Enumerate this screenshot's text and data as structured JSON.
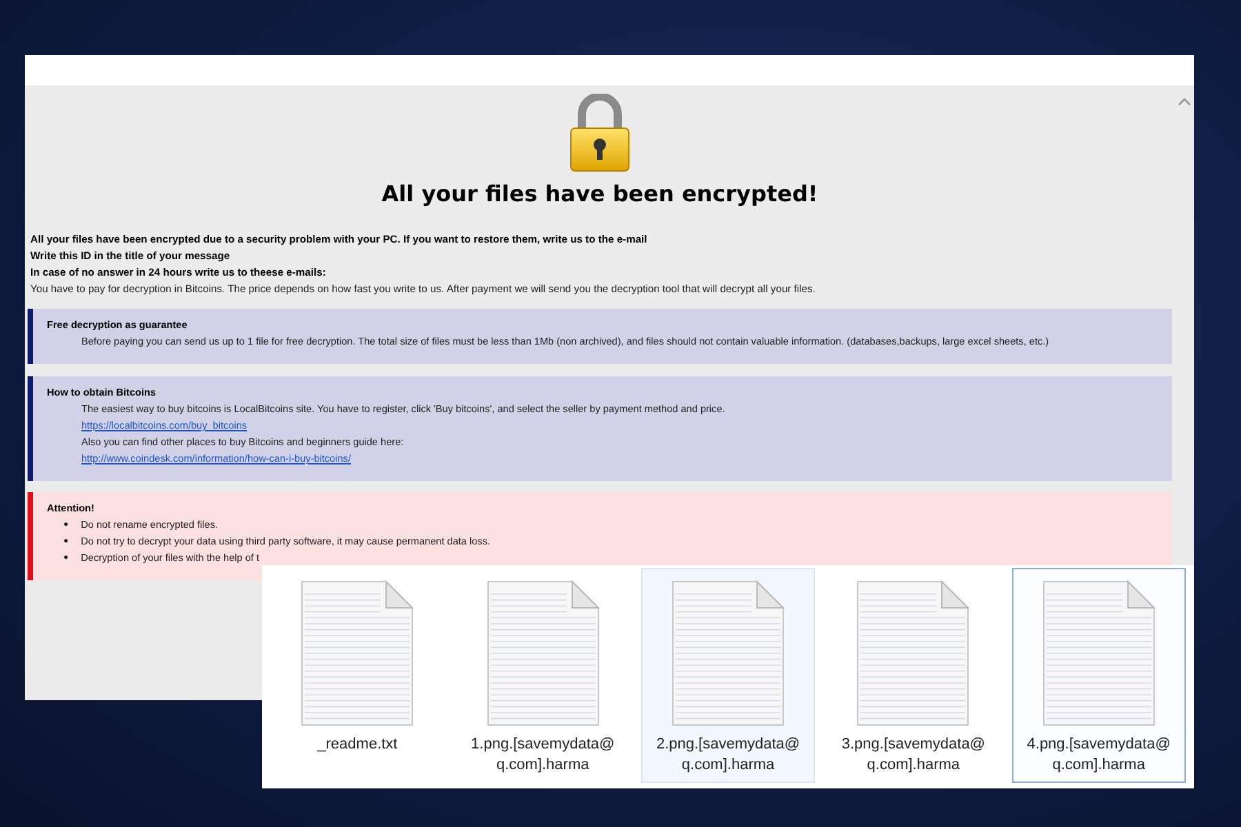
{
  "note": {
    "title": "All your files have been encrypted!",
    "intro": [
      {
        "text": "All your files have been encrypted due to a security problem with your PC. If you want to restore them, write us to the e-mail",
        "bold": true
      },
      {
        "text": "Write this ID in the title of your message",
        "bold": true
      },
      {
        "text": "In case of no answer in 24 hours write us to theese e-mails:",
        "bold": true
      },
      {
        "text": "You have to pay for decryption in Bitcoins. The price depends on how fast you write to us. After payment we will send you the decryption tool that will decrypt all your files.",
        "bold": false
      }
    ],
    "sections": [
      {
        "kind": "info",
        "heading": "Free decryption as guarantee",
        "lines": [
          {
            "kind": "text",
            "text": "Before paying you can send us up to 1 file for free decryption. The total size of files must be less than 1Mb (non archived), and files should not contain valuable information. (databases,backups, large excel sheets, etc.)"
          }
        ]
      },
      {
        "kind": "info",
        "heading": "How to obtain Bitcoins",
        "lines": [
          {
            "kind": "text",
            "text": "The easiest way to buy bitcoins is LocalBitcoins site. You have to register, click 'Buy bitcoins', and select the seller by payment method and price."
          },
          {
            "kind": "link",
            "text": "https://localbitcoins.com/buy_bitcoins"
          },
          {
            "kind": "text",
            "text": "Also you can find other places to buy Bitcoins and beginners guide here:"
          },
          {
            "kind": "link",
            "text": "http://www.coindesk.com/information/how-can-i-buy-bitcoins/"
          }
        ]
      },
      {
        "kind": "warning",
        "heading": "Attention!",
        "lines": [
          {
            "kind": "bullet",
            "marker": "●",
            "text": "Do not rename encrypted files."
          },
          {
            "kind": "bullet",
            "marker": "●",
            "text": "Do not try to decrypt your data using third party software, it may cause permanent data loss."
          },
          {
            "kind": "bullet",
            "marker": "●",
            "text": "Decryption of your files with the help of t"
          }
        ]
      }
    ]
  },
  "files": [
    {
      "name": "_readme.txt",
      "hovered": false,
      "selected": false
    },
    {
      "name": "1.png.[savemydata@q.com].harma",
      "hovered": false,
      "selected": false
    },
    {
      "name": "2.png.[savemydata@q.com].harma",
      "hovered": true,
      "selected": false
    },
    {
      "name": "3.png.[savemydata@q.com].harma",
      "hovered": false,
      "selected": false
    },
    {
      "name": "4.png.[savemydata@q.com].harma",
      "hovered": false,
      "selected": true
    }
  ]
}
